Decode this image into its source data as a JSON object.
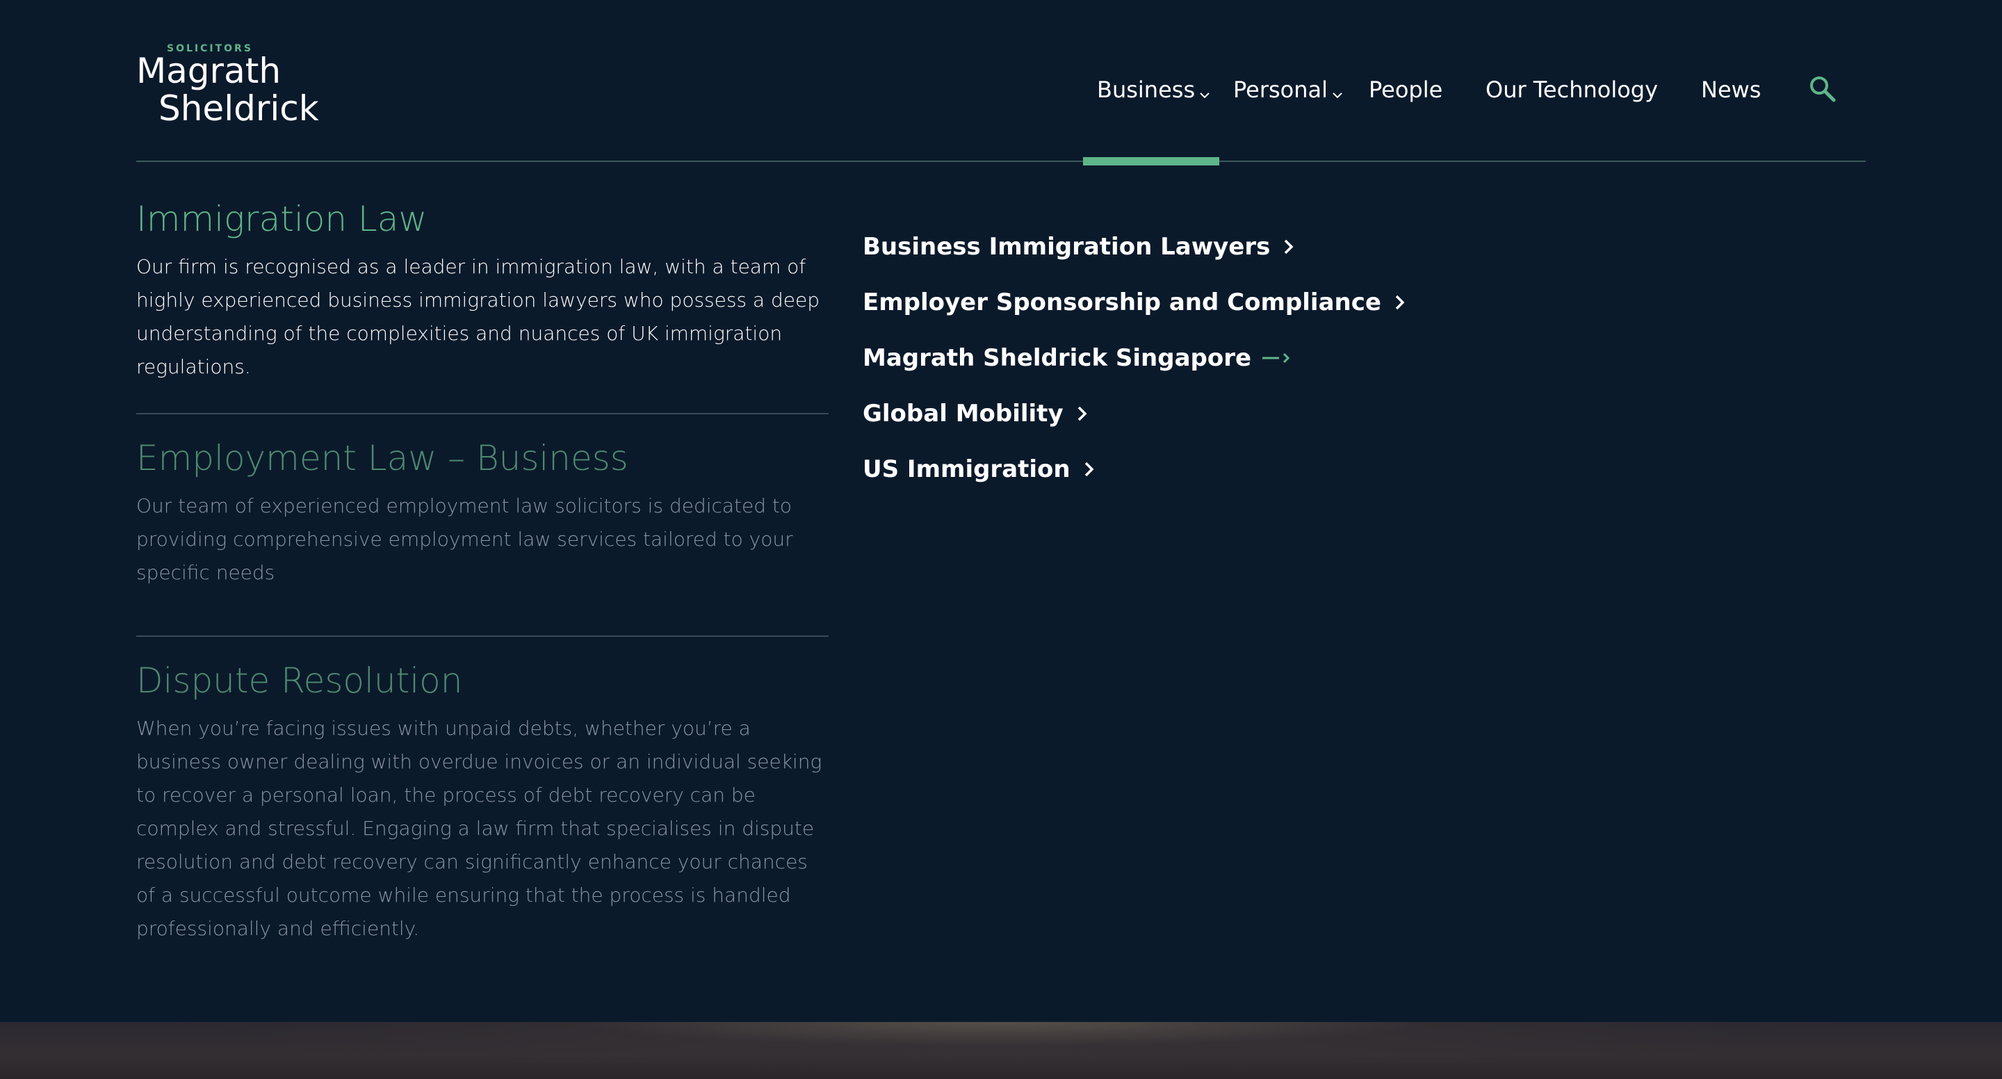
{
  "brand": {
    "kicker": "SOLICITORS",
    "name_line1": "Magrath",
    "name_line2": "Sheldrick"
  },
  "nav": {
    "items": [
      {
        "label": "Business",
        "has_dropdown": true,
        "active": true
      },
      {
        "label": "Personal",
        "has_dropdown": true,
        "active": false
      },
      {
        "label": "People",
        "has_dropdown": false,
        "active": false
      },
      {
        "label": "Our Technology",
        "has_dropdown": false,
        "active": false
      },
      {
        "label": "News",
        "has_dropdown": false,
        "active": false
      }
    ],
    "search_icon": "search-icon"
  },
  "services": [
    {
      "title": "Immigration Law",
      "description": "Our firm is recognised as a leader in immigration law, with a team of highly experienced business immigration lawyers who possess a deep understanding of the complexities and nuances of UK immigration regulations.",
      "active": true
    },
    {
      "title": "Employment Law – Business",
      "description": "Our team of experienced employment law solicitors is dedicated to providing comprehensive employment law services tailored to your specific needs",
      "active": false
    },
    {
      "title": "Dispute Resolution",
      "description": "When you’re facing issues with unpaid debts, whether you’re a business owner dealing with overdue invoices or an individual seeking to recover a personal loan, the process of debt recovery can be complex and stressful. Engaging a law firm that specialises in dispute resolution and debt recovery can significantly enhance your chances of a successful outcome while ensuring that the process is handled professionally and efficiently.",
      "active": false
    }
  ],
  "sublinks": [
    {
      "label": "Business Immigration Lawyers",
      "icon": "chevron-right-icon"
    },
    {
      "label": "Employer Sponsorship and Compliance",
      "icon": "chevron-right-icon"
    },
    {
      "label": "Magrath Sheldrick Singapore",
      "icon": "external-arrow-icon"
    },
    {
      "label": "Global Mobility",
      "icon": "chevron-right-icon"
    },
    {
      "label": "US Immigration",
      "icon": "chevron-right-icon"
    }
  ],
  "colors": {
    "background": "#0b1a2b",
    "accent": "#5fb58a",
    "text": "#ffffff",
    "muted_text": "#8a95a2"
  }
}
